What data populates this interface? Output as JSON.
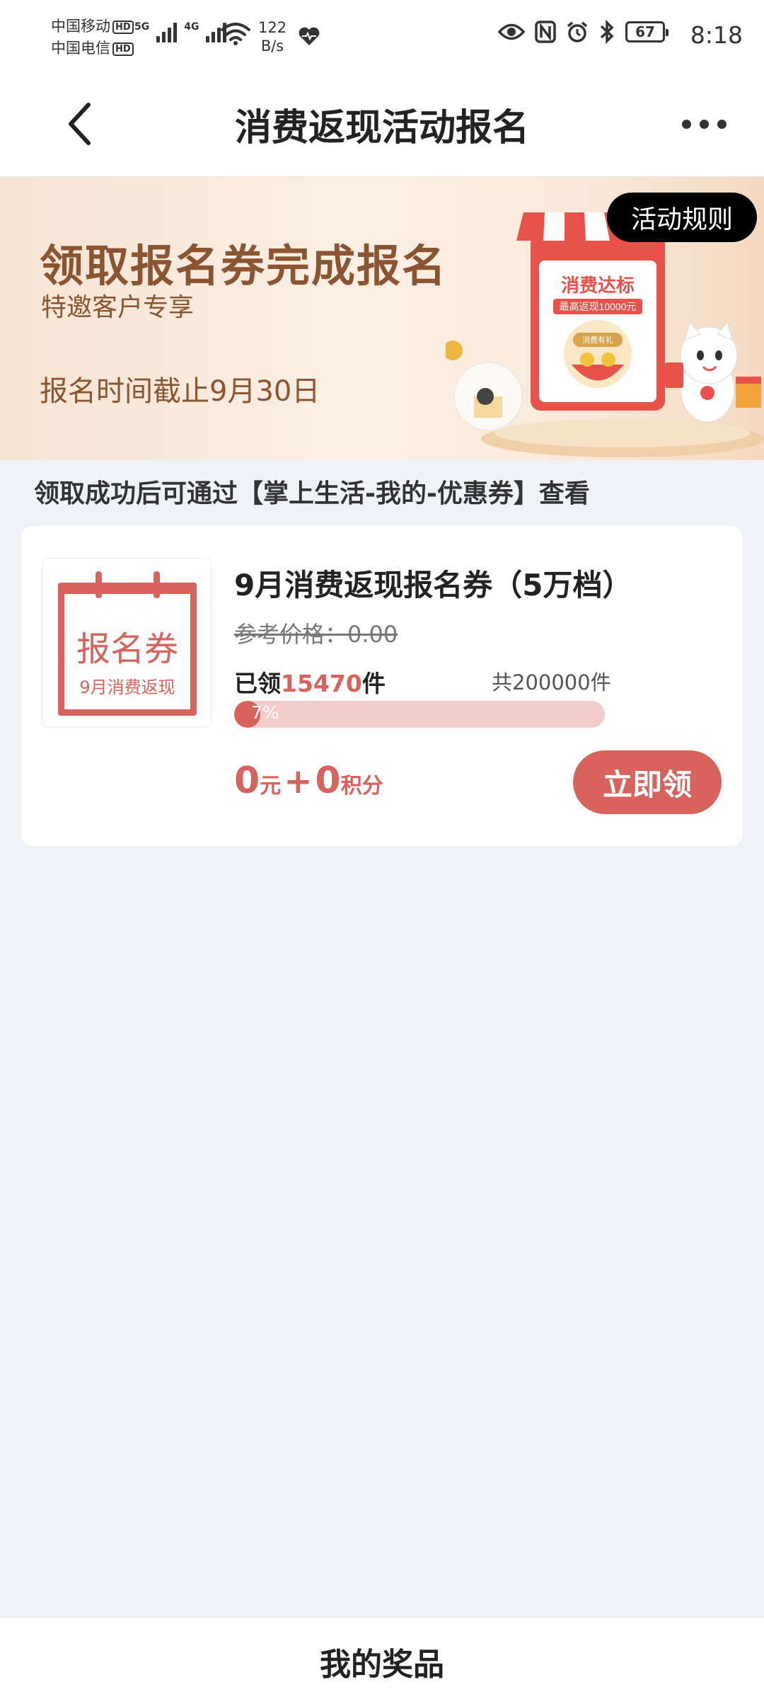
{
  "status_bar": {
    "carrier_1": "中国移动",
    "carrier_2": "中国电信",
    "hd_badge": "HD",
    "signal_1_label": "5G",
    "signal_2_label": "4G",
    "net_speed_value": "122",
    "net_speed_unit": "B/s",
    "battery": "67",
    "time": "8:18",
    "icons": [
      "wifi-icon",
      "heart-health-icon",
      "eye-icon",
      "nfc-icon",
      "alarm-icon",
      "bluetooth-icon",
      "battery-icon"
    ]
  },
  "nav": {
    "title": "消费返现活动报名",
    "back_icon": "chevron-left-icon",
    "more_icon": "more-dots-icon"
  },
  "banner": {
    "title": "领取报名券完成报名",
    "subtitle": "特邀客户专享",
    "deadline": "报名时间截止9月30日",
    "rules_button": "活动规则",
    "art_sign_title": "消费达标",
    "art_sign_sub": "最高返现10000元",
    "art_sign_tag": "消费有礼",
    "colors": {
      "text": "#8a5530",
      "accent_red": "#e8524a"
    }
  },
  "hint": "领取成功后可通过【掌上生活-我的-优惠券】查看",
  "coupon": {
    "thumb_title": "报名券",
    "thumb_sub": "9月消费返现",
    "name": "9月消费返现报名券（5万档）",
    "ref_price": "参考价格：0.00",
    "claimed_prefix": "已领",
    "claimed_count": "15470",
    "claimed_suffix": "件",
    "total": "共200000件",
    "progress_percent": 7,
    "progress_label": "7%",
    "price_cash": "0",
    "price_cash_unit": "元",
    "price_plus": "+",
    "price_points": "0",
    "price_points_unit": "积分",
    "claim_button": "立即领",
    "accent_color": "#d8625c"
  },
  "bottom": {
    "my_prizes": "我的奖品"
  }
}
